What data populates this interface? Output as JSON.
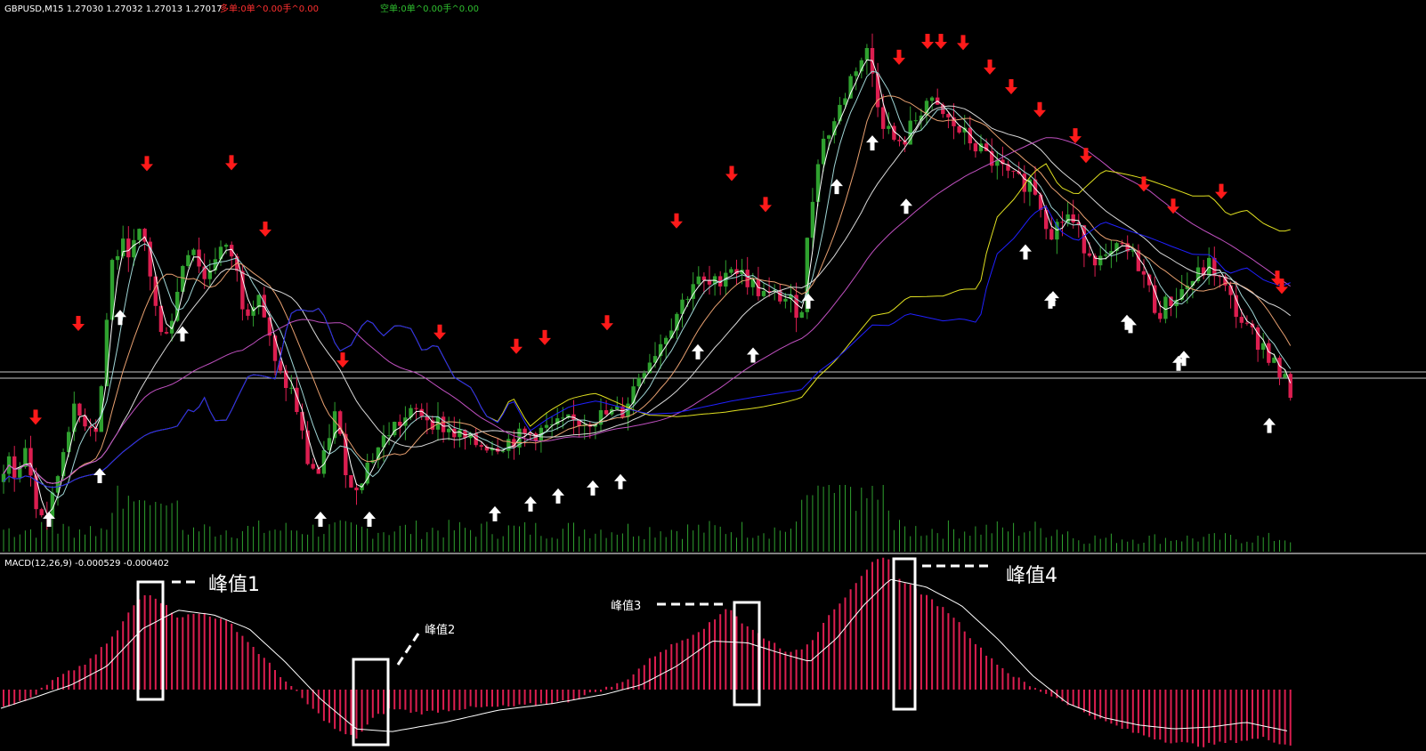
{
  "header": {
    "symbol_info": "GBPUSD,M15  1.27030 1.27032 1.27013 1.27017",
    "long_info": "多单:0单^0.00手^0.00",
    "short_info": "空单:0单^0.00手^0.00"
  },
  "macd_panel": {
    "label": "MACD(12,26,9) -0.000529 -0.000402"
  },
  "annotations": {
    "peak1": "峰值1",
    "peak2": "峰值2",
    "peak3": "峰值3",
    "peak4": "峰值4"
  },
  "colors": {
    "background": "#000000",
    "bull_candle": "#2fa12f",
    "bear_candle": "#dc1e50",
    "volume": "#2fa12f",
    "macd_hist": "#dc1e50",
    "macd_signal": "#ffffff",
    "sell_arrow": "#ff1a1a",
    "buy_arrow": "#ffffff",
    "ma_fast": "#ffffff",
    "ma_2": "#9fd5d5",
    "ma_3": "#e8a070",
    "ma_4": "#d8d8d8",
    "ma_5": "#c050c0",
    "ma_6": "#e0e020",
    "ma_7": "#2020ff"
  },
  "chart_data": [
    {
      "type": "candlestick",
      "symbol": "GBPUSD",
      "timeframe": "M15",
      "price_profile": {
        "x": [
          1,
          10,
          20,
          30,
          40,
          55,
          80,
          110,
          125,
          135,
          150,
          160,
          170,
          180,
          195,
          205,
          215,
          230,
          245,
          262,
          275,
          290,
          310,
          330,
          345,
          360,
          375,
          395,
          415,
          440,
          470,
          500,
          530,
          560,
          590,
          620,
          660,
          700,
          720,
          740,
          760,
          780,
          800,
          820,
          840,
          860,
          880,
          900,
          908,
          920,
          940,
          960,
          975,
          990,
          1010,
          1040,
          1060,
          1080,
          1100,
          1120,
          1140,
          1160,
          1180,
          1200,
          1220,
          1240,
          1260,
          1280,
          1300,
          1320,
          1340,
          1360,
          1380,
          1400,
          1420,
          1440,
          1450
        ],
        "close": [
          1.264,
          1.266,
          1.265,
          1.267,
          1.263,
          1.2625,
          1.269,
          1.268,
          1.278,
          1.279,
          1.279,
          1.28,
          1.277,
          1.2735,
          1.275,
          1.278,
          1.2795,
          1.277,
          1.279,
          1.2785,
          1.275,
          1.2765,
          1.2715,
          1.27,
          1.266,
          1.265,
          1.269,
          1.264,
          1.266,
          1.268,
          1.269,
          1.268,
          1.267,
          1.267,
          1.2675,
          1.268,
          1.2685,
          1.269,
          1.2715,
          1.273,
          1.275,
          1.277,
          1.2765,
          1.278,
          1.277,
          1.276,
          1.276,
          1.275,
          1.28,
          1.285,
          1.287,
          1.29,
          1.291,
          1.287,
          1.285,
          1.288,
          1.287,
          1.286,
          1.285,
          1.284,
          1.283,
          1.283,
          1.28,
          1.281,
          1.279,
          1.278,
          1.279,
          1.278,
          1.275,
          1.276,
          1.277,
          1.278,
          1.276,
          1.274,
          1.273,
          1.271,
          1.2702
        ]
      },
      "last_bar": {
        "open": 1.2703,
        "high": 1.27032,
        "low": 1.27013,
        "close": 1.27017
      },
      "moving_averages": 7,
      "sell_signal_arrows": 27,
      "buy_signal_arrows": 25,
      "horizontal_lines": 2,
      "grid": false
    },
    {
      "type": "bar",
      "name": "volume",
      "bars": 240,
      "relative_peaks": [
        "around first spike",
        "around middle rally spike"
      ]
    },
    {
      "type": "bar+line",
      "indicator": "MACD",
      "params": [
        12,
        26,
        9
      ],
      "main": -0.000529,
      "signal": -0.000402,
      "histogram_profile": {
        "x": [
          1,
          30,
          60,
          100,
          130,
          150,
          165,
          180,
          200,
          230,
          260,
          290,
          320,
          350,
          380,
          400,
          420,
          440,
          470,
          520,
          580,
          640,
          700,
          740,
          770,
          800,
          818,
          835,
          860,
          890,
          910,
          930,
          960,
          980,
          995,
          1010,
          1040,
          1070,
          1100,
          1130,
          1160,
          1190,
          1230,
          1270,
          1310,
          1350,
          1390,
          1420,
          1450
        ],
        "value": [
          -18,
          -12,
          10,
          30,
          60,
          90,
          105,
          95,
          78,
          82,
          70,
          40,
          10,
          -20,
          -45,
          -52,
          -30,
          -20,
          -25,
          -20,
          -18,
          -12,
          8,
          40,
          55,
          72,
          90,
          70,
          55,
          38,
          50,
          80,
          110,
          135,
          145,
          120,
          100,
          80,
          45,
          20,
          2,
          -10,
          -30,
          -45,
          -55,
          -60,
          -55,
          -52,
          -60
        ]
      },
      "signal_profile": {
        "x": [
          1,
          40,
          80,
          120,
          160,
          200,
          240,
          280,
          320,
          360,
          400,
          440,
          500,
          560,
          620,
          680,
          720,
          760,
          800,
          840,
          880,
          910,
          940,
          970,
          1000,
          1040,
          1080,
          1120,
          1160,
          1200,
          1240,
          1280,
          1320,
          1360,
          1400,
          1450
        ],
        "value": [
          -20,
          -8,
          5,
          25,
          65,
          85,
          80,
          65,
          30,
          -10,
          -42,
          -45,
          -35,
          -22,
          -15,
          -5,
          5,
          25,
          52,
          50,
          38,
          30,
          55,
          90,
          118,
          110,
          90,
          55,
          15,
          -15,
          -30,
          -38,
          -42,
          -40,
          -35,
          -45
        ]
      }
    }
  ]
}
